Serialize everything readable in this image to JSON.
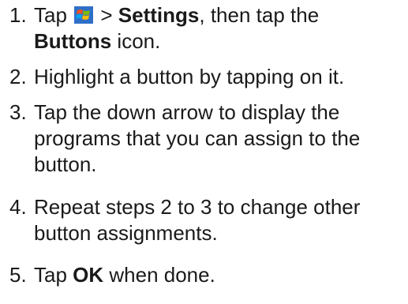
{
  "steps": [
    {
      "number": "1.",
      "part1": "Tap",
      "icon": "windows-start-icon",
      "part2": " > ",
      "bold1": "Settings",
      "part3": ", then tap the",
      "bold2": "Buttons",
      "part4": " icon."
    },
    {
      "number": "2.",
      "text": "Highlight a button by tapping on it."
    },
    {
      "number": "3.",
      "line1": "Tap the down arrow to display the",
      "line2": "programs that you can assign to the",
      "line3": "button."
    },
    {
      "number": "4.",
      "line1": "Repeat steps 2 to 3 to change other",
      "line2": "button assignments."
    },
    {
      "number": "5.",
      "part1": "Tap ",
      "bold": "OK",
      "part2": " when done."
    }
  ]
}
